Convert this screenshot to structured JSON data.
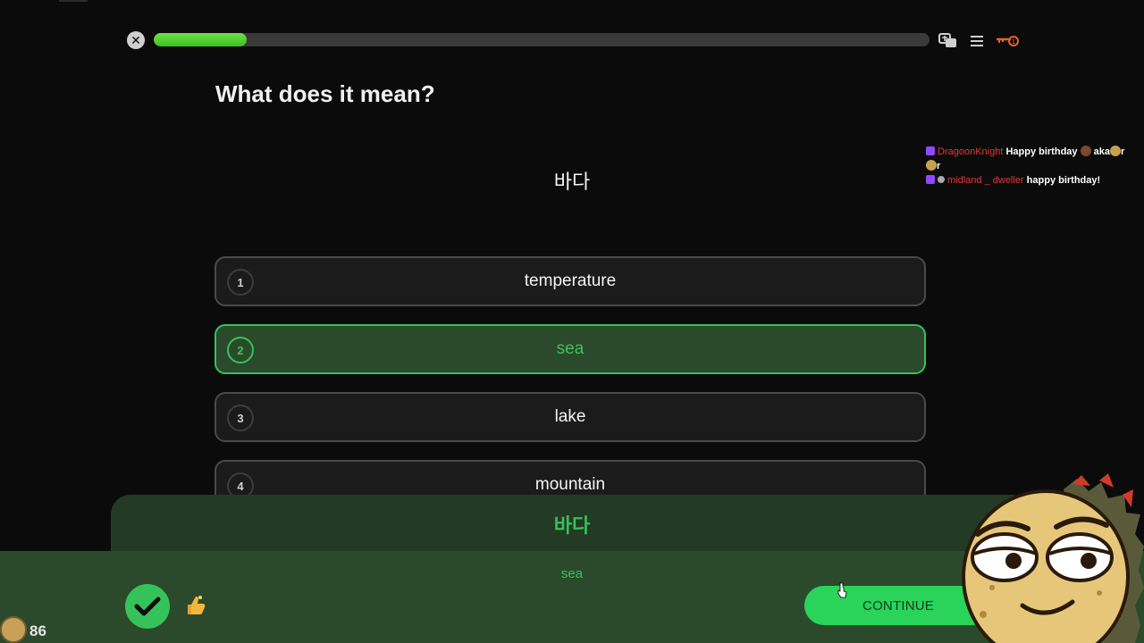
{
  "header": {
    "progress_percent": 12,
    "icons": [
      "close-icon",
      "translate-icon",
      "menu-icon",
      "key-icon"
    ]
  },
  "question": {
    "title": "What does it mean?",
    "prompt": "바다"
  },
  "options": [
    {
      "number": "1",
      "label": "temperature",
      "selected": false
    },
    {
      "number": "2",
      "label": "sea",
      "selected": true
    },
    {
      "number": "3",
      "label": "lake",
      "selected": false
    },
    {
      "number": "4",
      "label": "mountain",
      "selected": false
    }
  ],
  "result": {
    "word": "바다",
    "meaning": "sea",
    "continue_label": "CONTINUE",
    "status_icon": "check-icon",
    "reaction_icon": "thumbs-up-icon"
  },
  "chat": [
    {
      "username": "DragoonKnight",
      "message": "Happy birthday",
      "suffix": "aka",
      "tail": "r"
    },
    {
      "username": "midland _ dweller",
      "message": "happy birthday!"
    }
  ],
  "stream": {
    "viewer_count": "86"
  },
  "colors": {
    "accent_green": "#35c25a",
    "progress_green": "#4fd12a",
    "background": "#0b0b0b"
  }
}
